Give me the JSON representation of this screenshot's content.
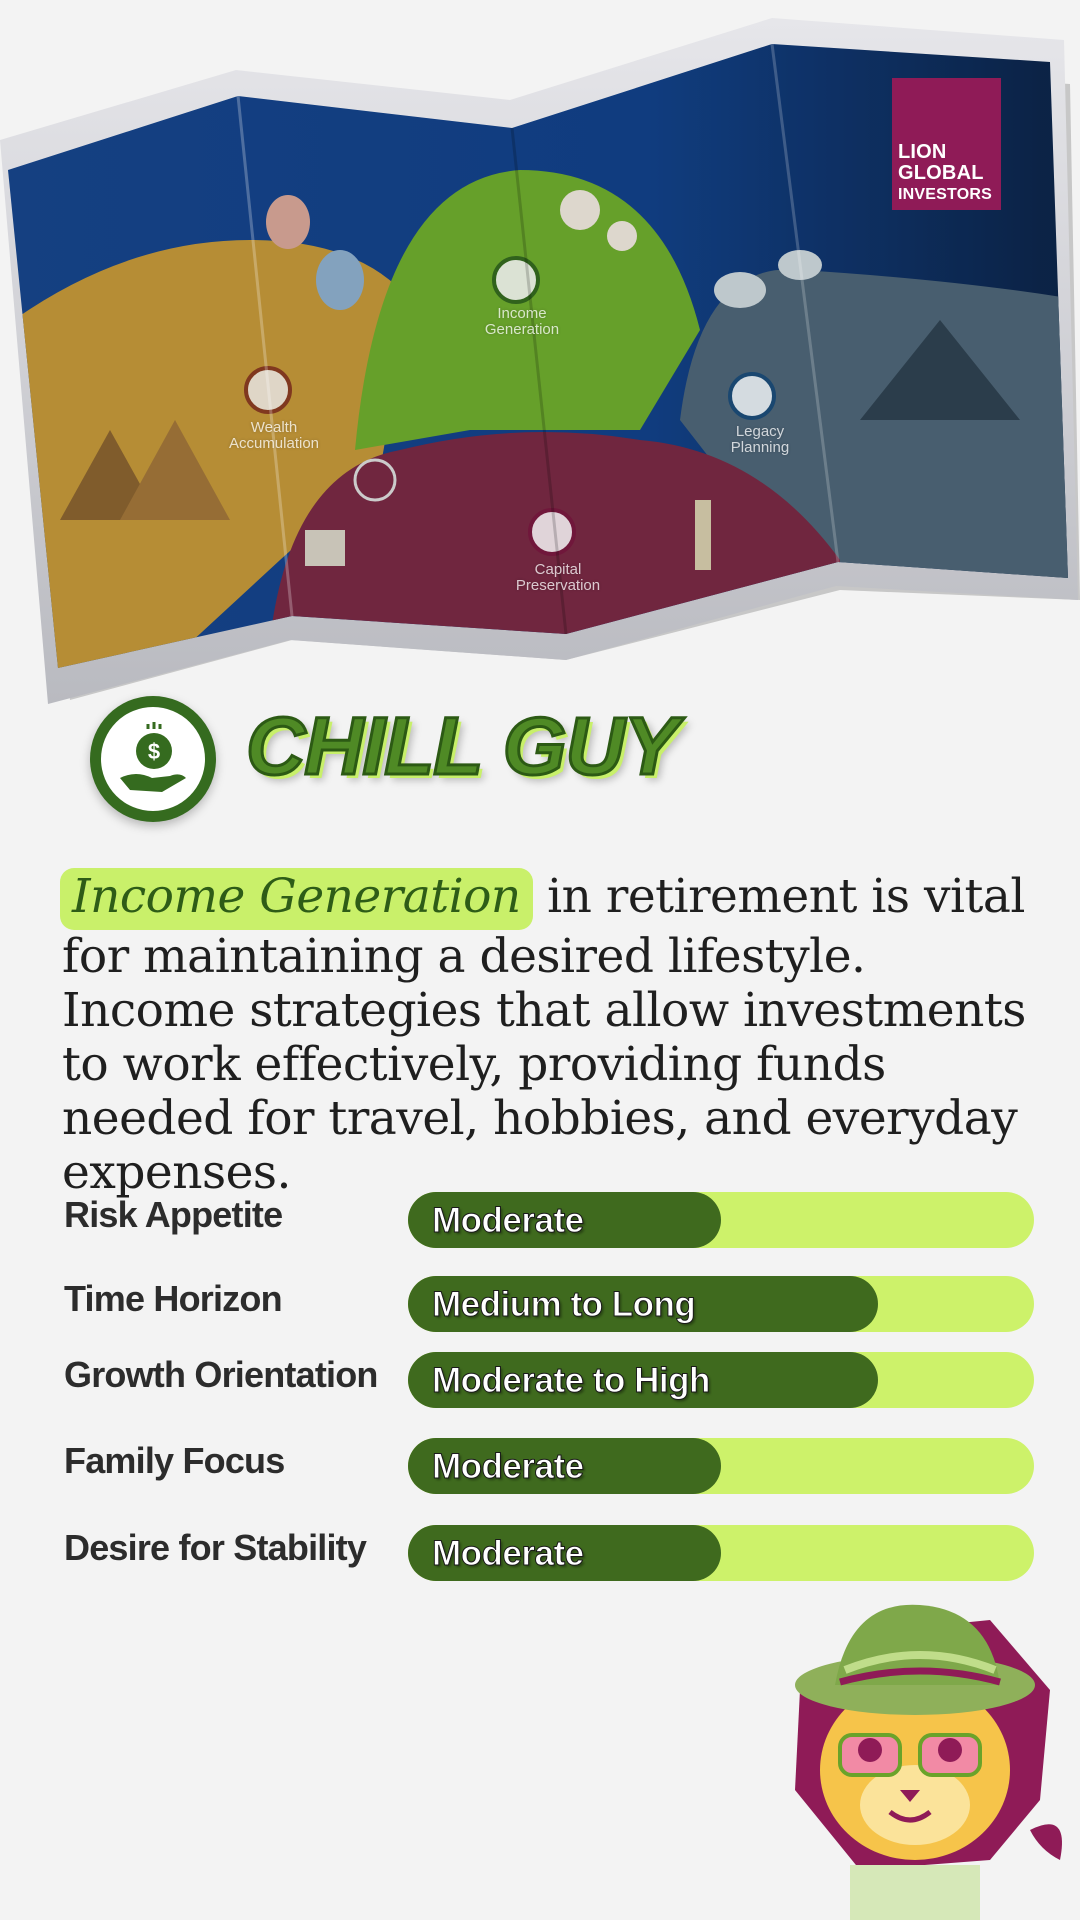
{
  "brand": {
    "line1": "LION",
    "line2": "GLOBAL",
    "line3": "INVESTORS",
    "color": "#8f1b57"
  },
  "map": {
    "regions": [
      {
        "label": "Wealth\nAccumulation",
        "icon": "dollar-coins-icon"
      },
      {
        "label": "Income\nGeneration",
        "icon": "hand-coin-icon"
      },
      {
        "label": "Legacy\nPlanning",
        "icon": "family-icon"
      },
      {
        "label": "Capital\nPreservation",
        "icon": "umbrella-dollar-icon"
      }
    ]
  },
  "persona": {
    "title": "CHILL GUY",
    "icon": "hand-holding-coin-icon",
    "accent": "#356b1f"
  },
  "description": {
    "highlight": "Income Generation",
    "text": " in retirement is vital for maintaining a desired lifestyle. Income strategies that allow investments to work effectively, providing funds needed for travel, hobbies, and everyday expenses.",
    "highlight_color": "#c9f06a"
  },
  "traits": [
    {
      "label": "Risk Appetite",
      "value": "Moderate",
      "level": 0.5
    },
    {
      "label": "Time Horizon",
      "value": "Medium to Long",
      "level": 0.75
    },
    {
      "label": "Growth Orientation",
      "value": "Moderate to High",
      "level": 0.75
    },
    {
      "label": "Family Focus",
      "value": "Moderate",
      "level": 0.5
    },
    {
      "label": "Desire for Stability",
      "value": "Moderate",
      "level": 0.5
    }
  ],
  "colors": {
    "bar_fill": "#3f6a1e",
    "bar_track": "#cdf26a"
  },
  "mascot": {
    "icon": "lion-mascot-icon"
  }
}
